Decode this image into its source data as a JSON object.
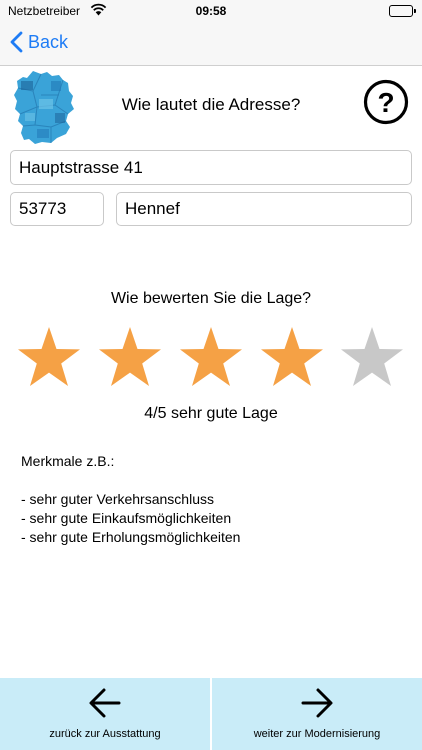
{
  "status_bar": {
    "carrier": "Netzbetreiber",
    "time": "09:58"
  },
  "nav": {
    "back_label": "Back"
  },
  "header": {
    "title": "Wie lautet die Adresse?",
    "help_symbol": "?"
  },
  "address": {
    "street": "Hauptstrasse 41",
    "zip": "53773",
    "city": "Hennef"
  },
  "rating": {
    "question": "Wie bewerten Sie die Lage?",
    "value": 4,
    "max": 5,
    "result_text": "4/5 sehr gute Lage",
    "filled_color": "#f5a145",
    "empty_color": "#c8c8c8"
  },
  "features": {
    "heading": "Merkmale z.B.:",
    "items": [
      "- sehr guter Verkehrsanschluss",
      "- sehr gute Einkaufsmöglichkeiten",
      "- sehr gute Erholungsmöglichkeiten"
    ]
  },
  "footer": {
    "back_label": "zurück zur Ausstattung",
    "next_label": "weiter zur Modernisierung"
  },
  "colors": {
    "accent": "#1e7cf5",
    "footer_bg": "#c9ecf8",
    "map_blue": "#3aa3d8"
  },
  "icons": {
    "wifi": "wifi-icon",
    "back": "chevron-left-icon",
    "map": "germany-map-icon",
    "help": "question-circle-icon",
    "star": "star-icon",
    "prev": "arrow-left-icon",
    "next": "arrow-right-icon"
  }
}
